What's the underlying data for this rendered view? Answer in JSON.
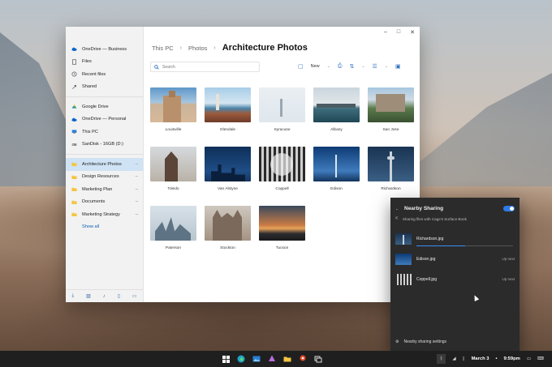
{
  "sidebar": {
    "onedrive_business": "OneDrive — Business",
    "items_business": [
      {
        "label": "Files",
        "icon": "file-icon"
      },
      {
        "label": "Recent files",
        "icon": "clock-icon"
      },
      {
        "label": "Shared",
        "icon": "share-icon"
      }
    ],
    "locations": [
      {
        "label": "Google Drive",
        "icon": "google-drive-icon"
      },
      {
        "label": "OneDrive — Personal",
        "icon": "cloud-icon"
      },
      {
        "label": "This PC",
        "icon": "computer-icon"
      },
      {
        "label": "SanDisk - 16GB (D:)",
        "icon": "usb-drive-icon"
      }
    ],
    "pinned": [
      {
        "label": "Architecture Photos",
        "pin": "⊸"
      },
      {
        "label": "Design Resources",
        "pin": "⊸"
      },
      {
        "label": "Marketing Plan",
        "pin": "⊸"
      },
      {
        "label": "Documents",
        "pin": "⊸"
      },
      {
        "label": "Marketing Strategy",
        "pin": "⊸"
      }
    ],
    "show_all": "Show all"
  },
  "breadcrumb": {
    "items": [
      "This PC",
      "Photos"
    ],
    "current": "Architecture Photos"
  },
  "search": {
    "placeholder": "Search"
  },
  "toolbar": {
    "new_label": "New"
  },
  "files": [
    {
      "name": "Louisville"
    },
    {
      "name": "Glendale"
    },
    {
      "name": "Syracuse"
    },
    {
      "name": "Albany"
    },
    {
      "name": "San Jose"
    },
    {
      "name": "Toledo"
    },
    {
      "name": "Van Alstyne"
    },
    {
      "name": "Coppell"
    },
    {
      "name": "Edison"
    },
    {
      "name": "Richardson"
    },
    {
      "name": "Paterson"
    },
    {
      "name": "Stockton"
    },
    {
      "name": "Tucson"
    }
  ],
  "nearby_sharing": {
    "title": "Nearby Sharing",
    "subtitle": "Sharing files with Cage's Surface Book",
    "transfers": [
      {
        "name": "Richardson.jpg",
        "status": "",
        "progress": 0.5
      },
      {
        "name": "Edison.jpg",
        "status": "Up next"
      },
      {
        "name": "Coppell.jpg",
        "status": "Up next"
      }
    ],
    "settings_label": "Nearby sharing settings"
  },
  "taskbar": {
    "date": "March 3",
    "separator": "•",
    "time": "9:59pm"
  }
}
